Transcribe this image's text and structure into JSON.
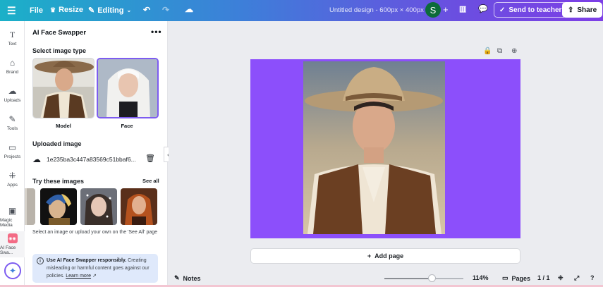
{
  "topbar": {
    "menu_icon": "hamburger-icon",
    "file_label": "File",
    "resize_label": "Resize",
    "editing_label": "Editing",
    "design_title": "Untitled design - 600px × 400px",
    "avatar_initial": "S",
    "send_to_teacher_label": "Send to teacher",
    "share_label": "Share"
  },
  "rail": {
    "items": [
      {
        "label": "Text",
        "icon": "text-icon"
      },
      {
        "label": "Brand",
        "icon": "brand-icon"
      },
      {
        "label": "Uploads",
        "icon": "upload-icon"
      },
      {
        "label": "Tools",
        "icon": "tools-icon"
      },
      {
        "label": "Projects",
        "icon": "folder-icon"
      },
      {
        "label": "Apps",
        "icon": "apps-icon"
      },
      {
        "label": "Magic Media",
        "icon": "magic-media-icon"
      },
      {
        "label": "AI Face Swa...",
        "icon": "ai-face-swapper-icon"
      }
    ]
  },
  "panel": {
    "title": "AI Face Swapper",
    "select_type_heading": "Select image type",
    "type_options": [
      {
        "label": "Model",
        "selected": false
      },
      {
        "label": "Face",
        "selected": true
      }
    ],
    "uploaded_heading": "Uploaded image",
    "uploaded_file": "1e235ba3c447a83569c51bbaf6...",
    "try_heading": "Try these images",
    "see_all": "See all",
    "help_text": "Select an image or upload your own on the 'See All' page",
    "notice_bold": "Use AI Face Swapper responsibly.",
    "notice_text": " Creating misleading or harmful content goes against our policies. ",
    "learn_more": "Learn more"
  },
  "canvas": {
    "page_color": "#8c4ffb",
    "add_page_label": "Add page"
  },
  "bottombar": {
    "notes_label": "Notes",
    "zoom_level": "114%",
    "zoom_fraction": 0.6,
    "pages_label": "Pages",
    "page_counter": "1 / 1"
  },
  "colors": {
    "accent": "#7d5cf0",
    "topbar_start": "#1bb0c8",
    "topbar_end": "#7d3fe6"
  }
}
